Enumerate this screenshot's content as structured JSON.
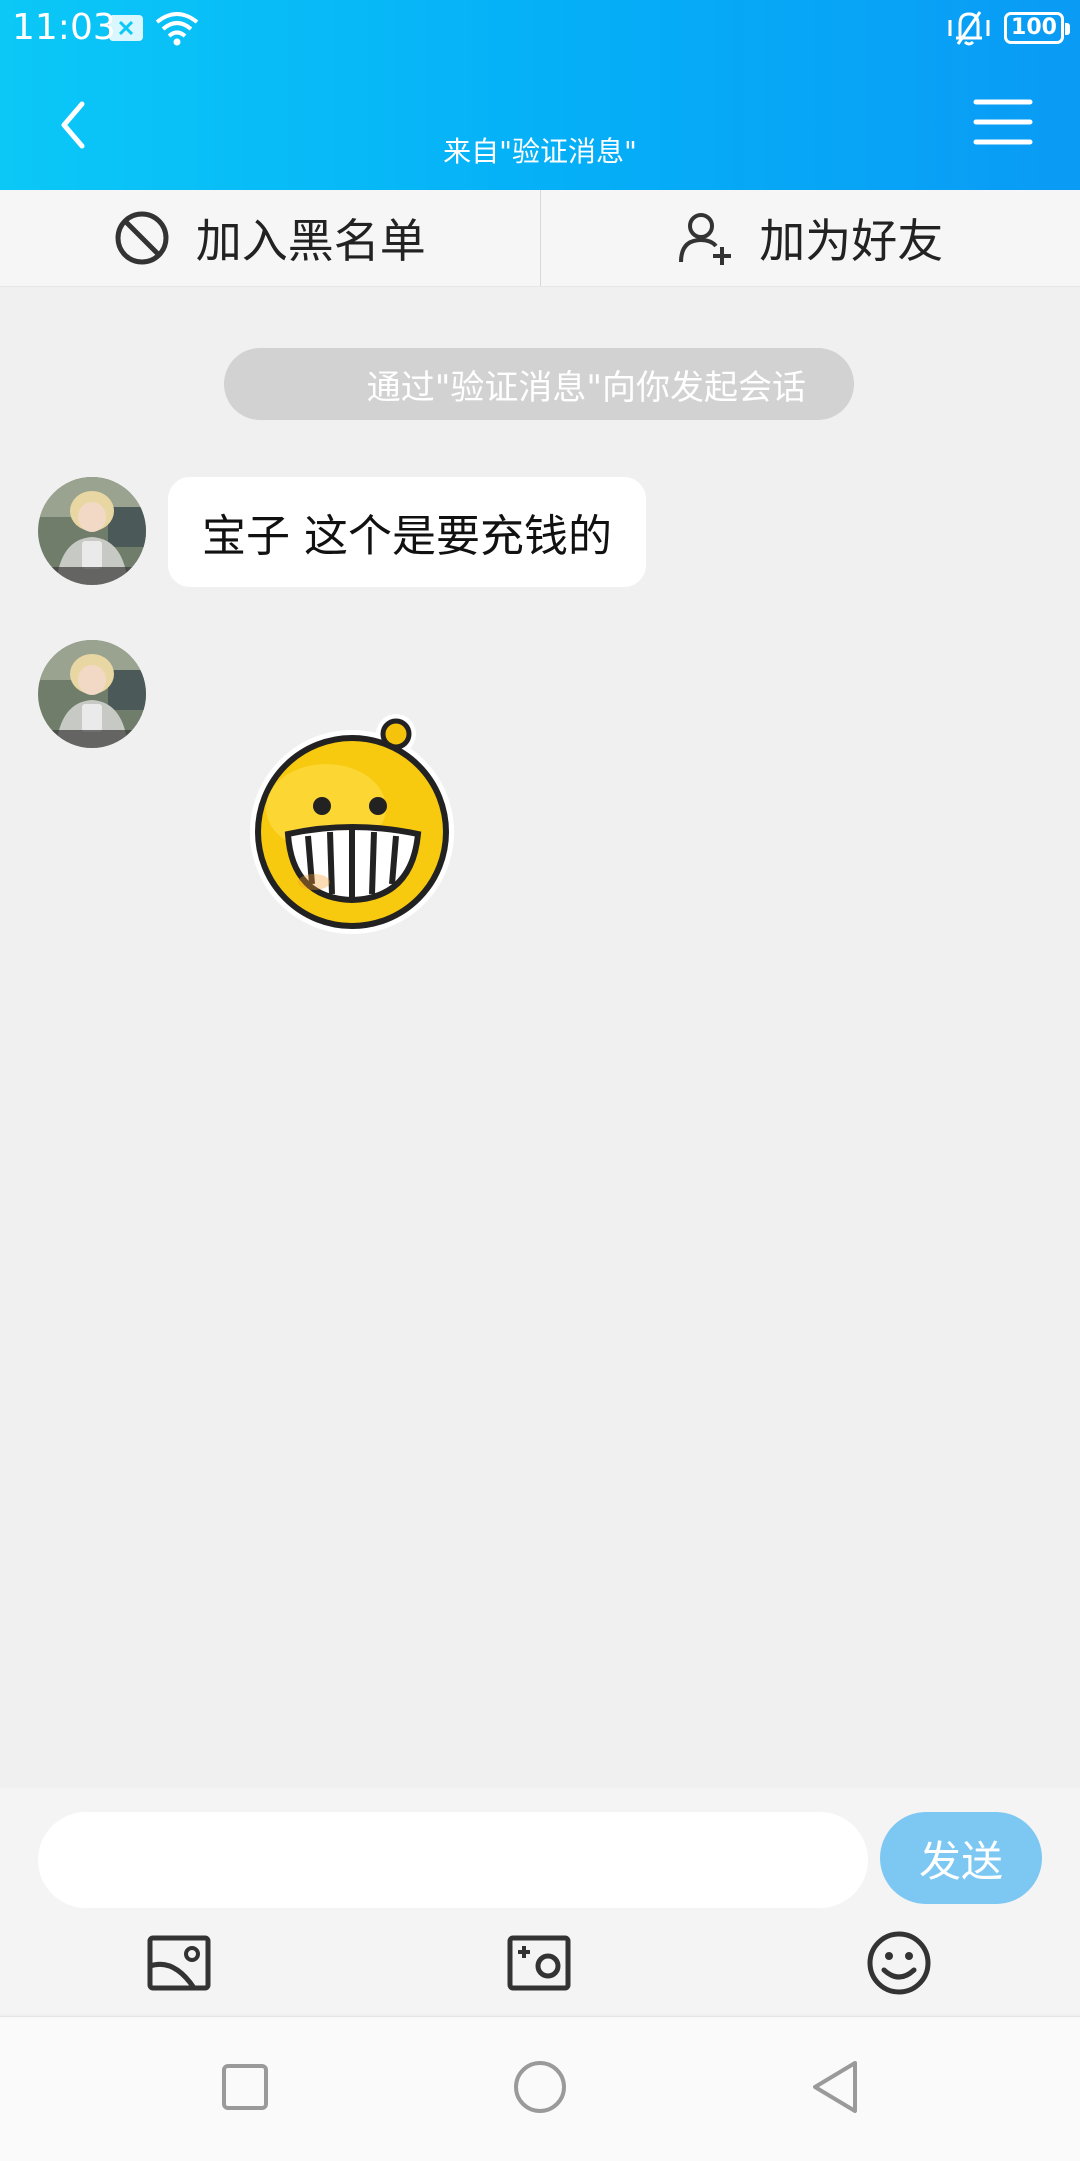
{
  "status_bar": {
    "time": "11:03",
    "battery": "100",
    "icons": [
      "sim-card-no-service-icon",
      "wifi-icon",
      "vibrate-icon",
      "battery-icon"
    ]
  },
  "header": {
    "subtitle": "来自\"验证消息\"",
    "left_icon": "back-chevron-icon",
    "right_icon": "menu-icon"
  },
  "actions": {
    "blacklist_label": "加入黑名单",
    "blacklist_icon": "block-icon",
    "add_friend_label": "加为好友",
    "add_friend_icon": "add-user-icon"
  },
  "conversation": {
    "system_notice": "通过\"验证消息\"向你发起会话",
    "messages": [
      {
        "type": "text",
        "text": "宝子 这个是要充钱的"
      },
      {
        "type": "sticker",
        "sticker": "grinning-face-sticker"
      }
    ]
  },
  "composer": {
    "input_value": "",
    "input_placeholder": "",
    "send_label": "发送",
    "tools": [
      "image-icon",
      "camera-icon",
      "emoji-icon"
    ]
  },
  "navbar": {
    "icons": [
      "recents-square-icon",
      "home-circle-icon",
      "back-triangle-icon"
    ]
  },
  "colors": {
    "header_start": "#0bc8f7",
    "header_end": "#0a9bf5",
    "send_button": "#7cc8f3",
    "background": "#f0f0f0"
  }
}
